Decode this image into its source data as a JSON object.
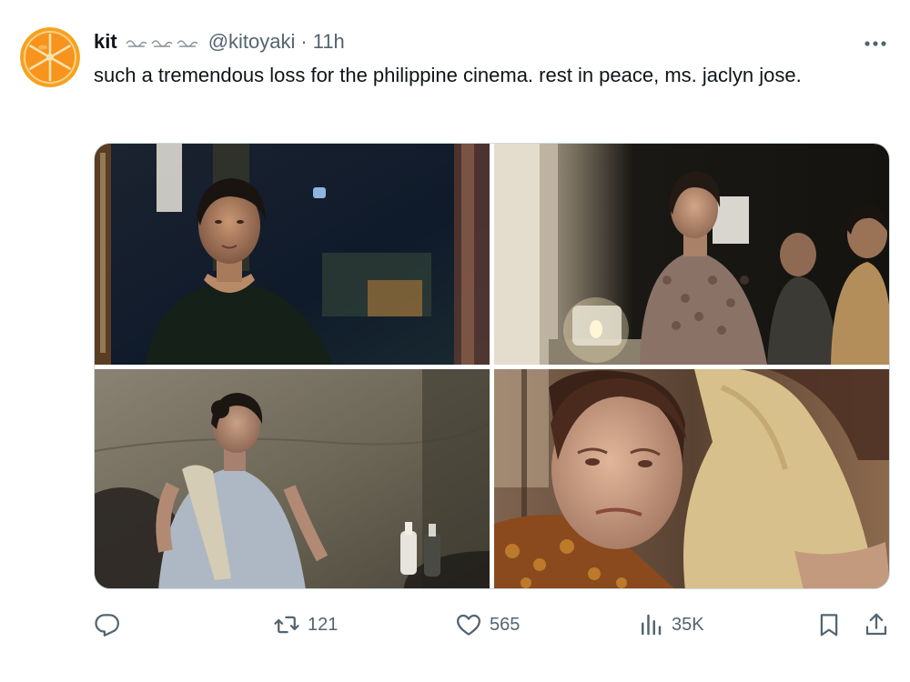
{
  "author": {
    "display_name": "kit",
    "handle": "@kitoyaki",
    "separator": "·",
    "time": "11h",
    "avatar_icon": "orange-slice-avatar",
    "name_decoration_icon": "wave-flourish-icon"
  },
  "tweet": {
    "text": "such a tremendous loss for the philippine cinema. rest in peace, ms. jaclyn jose."
  },
  "media": {
    "photos": [
      {
        "icon": "film-still-woman-night-street"
      },
      {
        "icon": "film-still-woman-candle-group"
      },
      {
        "icon": "film-still-woman-apron-room"
      },
      {
        "icon": "film-still-woman-embrace"
      }
    ]
  },
  "actions": {
    "reply": {
      "icon": "reply-icon",
      "count": ""
    },
    "retweet": {
      "icon": "retweet-icon",
      "count": "121"
    },
    "like": {
      "icon": "heart-icon",
      "count": "565"
    },
    "views": {
      "icon": "views-icon",
      "count": "35K"
    },
    "bookmark": {
      "icon": "bookmark-icon"
    },
    "share": {
      "icon": "share-icon"
    }
  },
  "colors": {
    "text_primary": "#0f1419",
    "text_secondary": "#536471",
    "border": "#cfd9de",
    "avatar_orange": "#f7941d"
  }
}
